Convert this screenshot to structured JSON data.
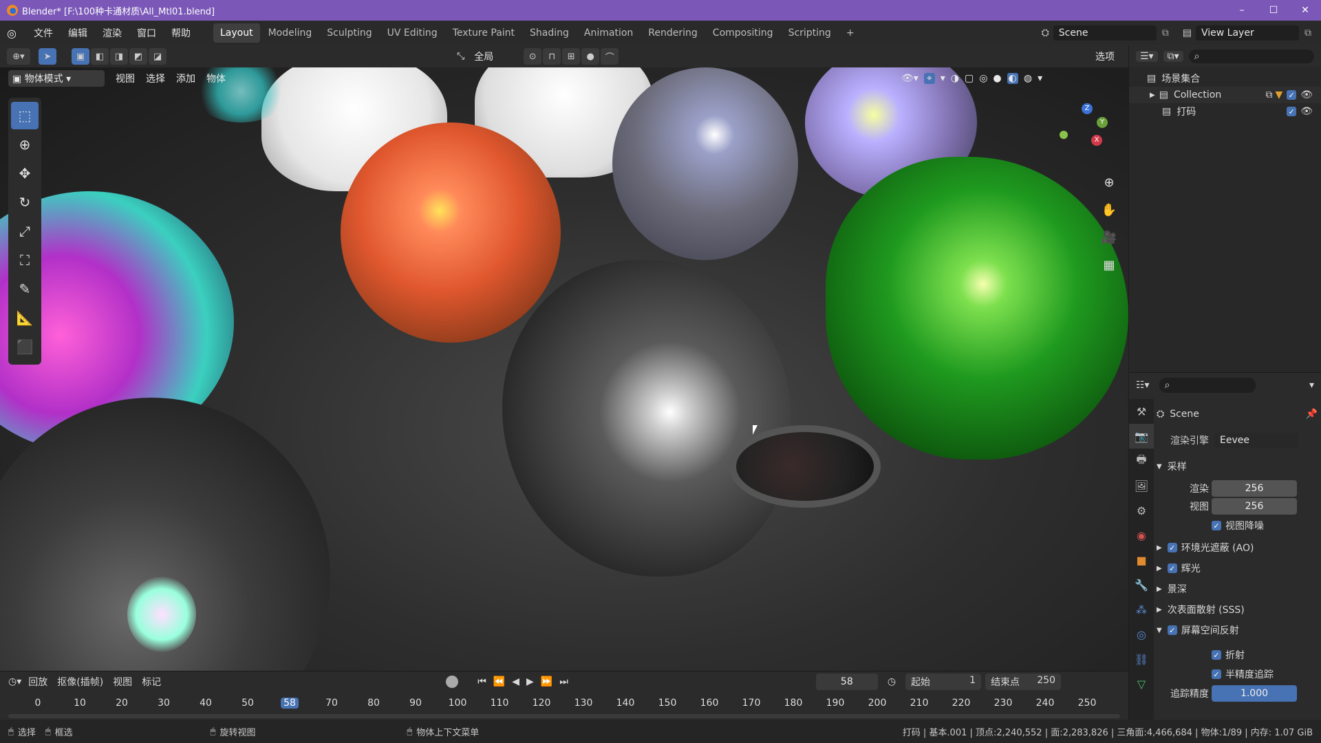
{
  "titlebar": {
    "title": "Blender* [F:\\100种卡通材质\\All_Mtl01.blend]"
  },
  "menubar": {
    "menus": [
      "文件",
      "编辑",
      "渲染",
      "窗口",
      "帮助"
    ],
    "workspaces": [
      "Layout",
      "Modeling",
      "Sculpting",
      "UV Editing",
      "Texture Paint",
      "Shading",
      "Animation",
      "Rendering",
      "Compositing",
      "Scripting"
    ],
    "active_workspace": "Layout",
    "add_tab": "+",
    "scene": "Scene",
    "view_layer": "View Layer"
  },
  "toolrow": {
    "orientation": "全局",
    "options": "选项"
  },
  "viewport": {
    "mode": "物体模式",
    "menus": [
      "视图",
      "选择",
      "添加",
      "物体"
    ],
    "gizmo_axes": {
      "x": "X",
      "y": "Y",
      "z": "Z"
    }
  },
  "outliner": {
    "root": "场景集合",
    "items": [
      {
        "label": "Collection"
      },
      {
        "label": "打码"
      }
    ]
  },
  "properties": {
    "scene_name": "Scene",
    "render_engine_label": "渲染引擎",
    "render_engine": "Eevee",
    "sampling": {
      "label": "采样",
      "render_label": "渲染",
      "render_value": "256",
      "viewport_label": "视图",
      "viewport_value": "256",
      "denoise_label": "视图降噪"
    },
    "sections": [
      "环境光遮蔽 (AO)",
      "辉光",
      "景深",
      "次表面散射 (SSS)",
      "屏幕空间反射"
    ],
    "ssr": {
      "refraction": "折射",
      "half_res": "半精度追踪",
      "trace_precision_label": "追踪精度",
      "trace_precision": "1.000"
    }
  },
  "timeline": {
    "menus": [
      "回放",
      "抠像(插帧)",
      "视图",
      "标记"
    ],
    "current_frame": "58",
    "start_label": "起始",
    "start": "1",
    "end_label": "结束点",
    "end": "250",
    "ticks": [
      "0",
      "10",
      "20",
      "30",
      "40",
      "50",
      "58",
      "70",
      "80",
      "90",
      "100",
      "110",
      "120",
      "130",
      "140",
      "150",
      "160",
      "170",
      "180",
      "190",
      "200",
      "210",
      "220",
      "230",
      "240",
      "250"
    ]
  },
  "statusbar": {
    "select": "选择",
    "box_select": "框选",
    "rotate_view": "旋转视图",
    "context_menu": "物体上下文菜单",
    "stats": "打码 | 基本.001 | 顶点:2,240,552 | 面:2,283,826 | 三角面:4,466,684 | 物体:1/89 | 内存: 1.07 GiB"
  },
  "colors": {
    "accent": "#4772b3",
    "titlebar": "#7b58b8"
  }
}
